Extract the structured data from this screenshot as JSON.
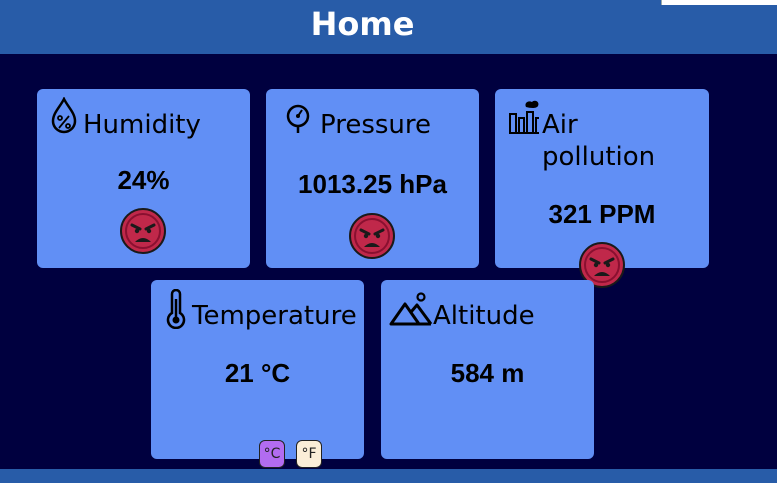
{
  "header": {
    "title": "Home"
  },
  "cards": {
    "humidity": {
      "label": "Humidity",
      "value": "24%",
      "icon": "humidity-drop-icon",
      "status": "angry-face"
    },
    "pressure": {
      "label": "Pressure",
      "value": "1013.25 hPa",
      "icon": "gauge-icon",
      "status": "angry-face"
    },
    "air_pollution": {
      "label_line1": "Air",
      "label_line2": "pollution",
      "value": "321 PPM",
      "icon": "factory-icon",
      "status": "angry-face"
    },
    "temperature": {
      "label": "Temperature",
      "value": "21 °C",
      "icon": "thermometer-icon",
      "unit_c": "°C",
      "unit_f": "°F"
    },
    "altitude": {
      "label": "Altitude",
      "value": "584 m",
      "icon": "mountain-icon"
    }
  },
  "colors": {
    "background": "#00003f",
    "header": "#285ca8",
    "card": "#618ff5",
    "face": "#c0284a",
    "unit_c_active": "#b26cf0",
    "unit_f": "#fbeed8"
  }
}
